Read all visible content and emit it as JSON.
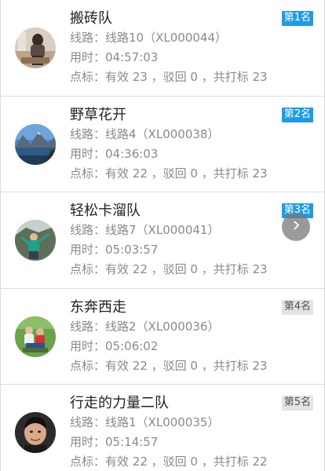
{
  "route_label": "线路：",
  "time_label": "用时：",
  "points_label": "点标：",
  "teams": [
    {
      "name": "搬砖队",
      "route": "线路10（XL000044）",
      "time": "04:57:03",
      "points": "有效 23 ，驳回 0 ，共打标 23",
      "rank": "第1名",
      "rank_color": "#1e9be6"
    },
    {
      "name": "野草花开",
      "route": "线路4（XL000038）",
      "time": "04:36:03",
      "points": "有效 22 ，驳回 0 ，共打标 23",
      "rank": "第2名",
      "rank_color": "#1e9be6"
    },
    {
      "name": "轻松卡溜队",
      "route": "线路7（XL000041）",
      "time": "05:03:57",
      "points": "有效 22 ，驳回 0 ，共打标 23",
      "rank": "第3名",
      "rank_color": "#1e9be6"
    },
    {
      "name": "东奔西走",
      "route": "线路2（XL000036）",
      "time": "05:06:02",
      "points": "有效 22 ，驳回 0 ，共打标 23",
      "rank": "第4名",
      "rank_color": "#e3e3e3"
    },
    {
      "name": "行走的力量二队",
      "route": "线路1（XL000035）",
      "time": "05:14:57",
      "points": "有效 22 ，驳回 0 ，共打标 22",
      "rank": "第5名",
      "rank_color": "#e3e3e3"
    }
  ],
  "next_button_icon": "chevron-right-icon"
}
